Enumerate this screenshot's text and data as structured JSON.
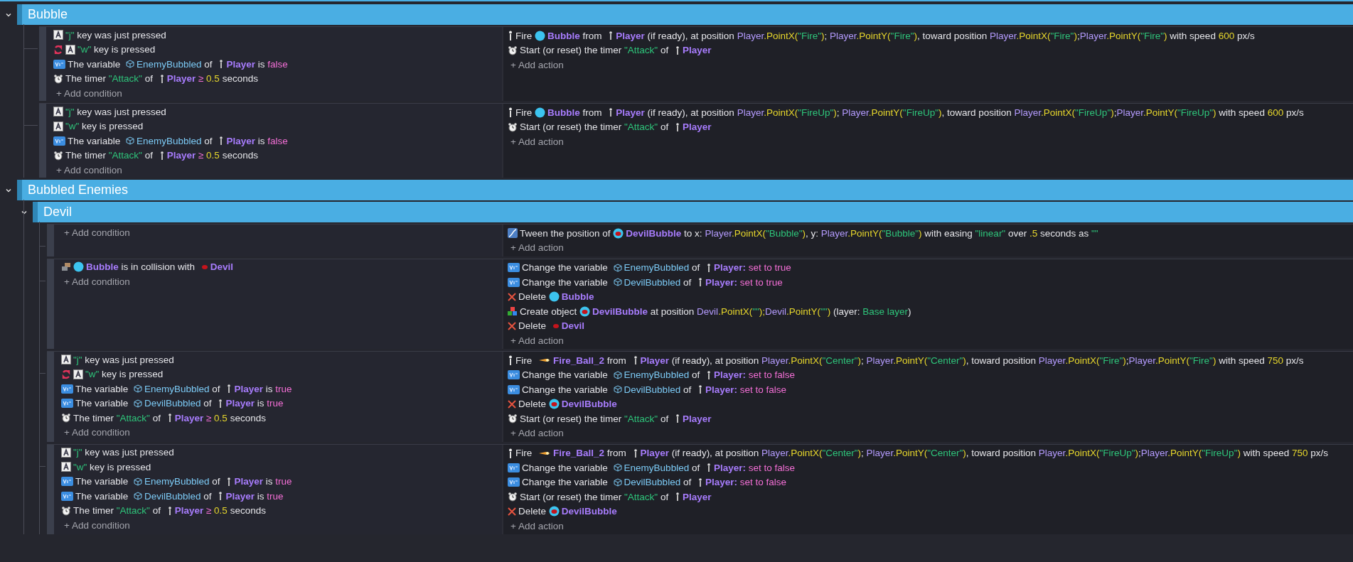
{
  "items": [
    {
      "kind": "group",
      "title": "Bubble",
      "expanded": true,
      "items": [
        {
          "kind": "event",
          "add_condition": "+ Add condition",
          "add_action": "+ Add action",
          "conditions": [
            {
              "kind": "key",
              "inverted": false,
              "parts": [
                {
                  "kind": "s",
                  "text": "\"j\""
                },
                {
                  "kind": "t",
                  "text": " key was just pressed"
                }
              ]
            },
            {
              "kind": "key",
              "inverted": true,
              "parts": [
                {
                  "kind": "s",
                  "text": "\"w\""
                },
                {
                  "kind": "t",
                  "text": " key is pressed"
                }
              ]
            },
            {
              "kind": "var",
              "inverted": false,
              "parts": [
                {
                  "kind": "t",
                  "text": "The variable "
                },
                {
                  "kind": "v",
                  "text": "EnemyBubbled"
                },
                {
                  "kind": "t",
                  "text": " of "
                },
                {
                  "kind": "player",
                  "text": "Player"
                },
                {
                  "kind": "t",
                  "text": " is "
                },
                {
                  "kind": "b",
                  "text": "false"
                }
              ]
            },
            {
              "kind": "timer",
              "inverted": false,
              "parts": [
                {
                  "kind": "t",
                  "text": "The timer "
                },
                {
                  "kind": "s",
                  "text": "\"Attack\""
                },
                {
                  "kind": "t",
                  "text": " of "
                },
                {
                  "kind": "player",
                  "text": "Player"
                },
                {
                  "kind": "b",
                  "text": " ≥ "
                },
                {
                  "kind": "n",
                  "text": "0.5"
                },
                {
                  "kind": "t",
                  "text": " seconds"
                }
              ]
            }
          ],
          "actions": [
            {
              "kind": "fire",
              "parts": [
                {
                  "kind": "t",
                  "text": "Fire "
                },
                {
                  "kind": "bubble",
                  "text": "Bubble"
                },
                {
                  "kind": "t",
                  "text": " from "
                },
                {
                  "kind": "player",
                  "text": "Player"
                },
                {
                  "kind": "t",
                  "text": " (if ready), at position "
                },
                {
                  "kind": "e",
                  "text": "Player"
                },
                {
                  "kind": "f",
                  "text": ".PointX("
                },
                {
                  "kind": "s",
                  "text": "\"Fire\""
                },
                {
                  "kind": "f",
                  "text": ")"
                },
                {
                  "kind": "t",
                  "text": "; "
                },
                {
                  "kind": "e",
                  "text": "Player"
                },
                {
                  "kind": "f",
                  "text": ".PointY("
                },
                {
                  "kind": "s",
                  "text": "\"Fire\""
                },
                {
                  "kind": "f",
                  "text": ")"
                },
                {
                  "kind": "t",
                  "text": ", toward position "
                },
                {
                  "kind": "e",
                  "text": "Player"
                },
                {
                  "kind": "f",
                  "text": ".PointX("
                },
                {
                  "kind": "s",
                  "text": "\"Fire\""
                },
                {
                  "kind": "f",
                  "text": ")"
                },
                {
                  "kind": "t",
                  "text": ";"
                },
                {
                  "kind": "e",
                  "text": "Player"
                },
                {
                  "kind": "f",
                  "text": ".PointY("
                },
                {
                  "kind": "s",
                  "text": "\"Fire\""
                },
                {
                  "kind": "f",
                  "text": ")"
                },
                {
                  "kind": "t",
                  "text": " with speed "
                },
                {
                  "kind": "n",
                  "text": "600"
                },
                {
                  "kind": "t",
                  "text": " px/s"
                }
              ]
            },
            {
              "kind": "timer",
              "parts": [
                {
                  "kind": "t",
                  "text": "Start (or reset) the timer "
                },
                {
                  "kind": "s",
                  "text": "\"Attack\""
                },
                {
                  "kind": "t",
                  "text": " of "
                },
                {
                  "kind": "player",
                  "text": "Player"
                }
              ]
            }
          ]
        },
        {
          "kind": "event",
          "add_condition": "+ Add condition",
          "add_action": "+ Add action",
          "conditions": [
            {
              "kind": "key",
              "inverted": false,
              "parts": [
                {
                  "kind": "s",
                  "text": "\"j\""
                },
                {
                  "kind": "t",
                  "text": " key was just pressed"
                }
              ]
            },
            {
              "kind": "key",
              "inverted": false,
              "parts": [
                {
                  "kind": "s",
                  "text": "\"w\""
                },
                {
                  "kind": "t",
                  "text": " key is pressed"
                }
              ]
            },
            {
              "kind": "var",
              "inverted": false,
              "parts": [
                {
                  "kind": "t",
                  "text": "The variable "
                },
                {
                  "kind": "v",
                  "text": "EnemyBubbled"
                },
                {
                  "kind": "t",
                  "text": " of "
                },
                {
                  "kind": "player",
                  "text": "Player"
                },
                {
                  "kind": "t",
                  "text": " is "
                },
                {
                  "kind": "b",
                  "text": "false"
                }
              ]
            },
            {
              "kind": "timer",
              "inverted": false,
              "parts": [
                {
                  "kind": "t",
                  "text": "The timer "
                },
                {
                  "kind": "s",
                  "text": "\"Attack\""
                },
                {
                  "kind": "t",
                  "text": " of "
                },
                {
                  "kind": "player",
                  "text": "Player"
                },
                {
                  "kind": "b",
                  "text": " ≥ "
                },
                {
                  "kind": "n",
                  "text": "0.5"
                },
                {
                  "kind": "t",
                  "text": " seconds"
                }
              ]
            }
          ],
          "actions": [
            {
              "kind": "fire",
              "parts": [
                {
                  "kind": "t",
                  "text": "Fire "
                },
                {
                  "kind": "bubble",
                  "text": "Bubble"
                },
                {
                  "kind": "t",
                  "text": " from "
                },
                {
                  "kind": "player",
                  "text": "Player"
                },
                {
                  "kind": "t",
                  "text": " (if ready), at position "
                },
                {
                  "kind": "e",
                  "text": "Player"
                },
                {
                  "kind": "f",
                  "text": ".PointX("
                },
                {
                  "kind": "s",
                  "text": "\"FireUp\""
                },
                {
                  "kind": "f",
                  "text": ")"
                },
                {
                  "kind": "t",
                  "text": "; "
                },
                {
                  "kind": "e",
                  "text": "Player"
                },
                {
                  "kind": "f",
                  "text": ".PointY("
                },
                {
                  "kind": "s",
                  "text": "\"FireUp\""
                },
                {
                  "kind": "f",
                  "text": ")"
                },
                {
                  "kind": "t",
                  "text": ", toward position "
                },
                {
                  "kind": "e",
                  "text": "Player"
                },
                {
                  "kind": "f",
                  "text": ".PointX("
                },
                {
                  "kind": "s",
                  "text": "\"FireUp\""
                },
                {
                  "kind": "f",
                  "text": ")"
                },
                {
                  "kind": "t",
                  "text": ";"
                },
                {
                  "kind": "e",
                  "text": "Player"
                },
                {
                  "kind": "f",
                  "text": ".PointY("
                },
                {
                  "kind": "s",
                  "text": "\"FireUp\""
                },
                {
                  "kind": "f",
                  "text": ")"
                },
                {
                  "kind": "t",
                  "text": " with speed "
                },
                {
                  "kind": "n",
                  "text": "600"
                },
                {
                  "kind": "t",
                  "text": " px/s"
                }
              ]
            },
            {
              "kind": "timer",
              "parts": [
                {
                  "kind": "t",
                  "text": "Start (or reset) the timer "
                },
                {
                  "kind": "s",
                  "text": "\"Attack\""
                },
                {
                  "kind": "t",
                  "text": " of "
                },
                {
                  "kind": "player",
                  "text": "Player"
                }
              ]
            }
          ]
        }
      ]
    },
    {
      "kind": "group",
      "title": "Bubbled Enemies",
      "expanded": true,
      "items": [
        {
          "kind": "group",
          "title": "Devil",
          "expanded": true,
          "items": [
            {
              "kind": "event",
              "add_condition": "+ Add condition",
              "add_action": "+ Add action",
              "actions": [
                {
                  "kind": "tween",
                  "parts": [
                    {
                      "kind": "t",
                      "text": "Tween the position of "
                    },
                    {
                      "kind": "devilbubble",
                      "text": "DevilBubble"
                    },
                    {
                      "kind": "t",
                      "text": " to x: "
                    },
                    {
                      "kind": "e",
                      "text": "Player"
                    },
                    {
                      "kind": "f",
                      "text": ".PointX("
                    },
                    {
                      "kind": "s",
                      "text": "\"Bubble\""
                    },
                    {
                      "kind": "f",
                      "text": ")"
                    },
                    {
                      "kind": "t",
                      "text": ", y: "
                    },
                    {
                      "kind": "e",
                      "text": "Player"
                    },
                    {
                      "kind": "f",
                      "text": ".PointY("
                    },
                    {
                      "kind": "s",
                      "text": "\"Bubble\""
                    },
                    {
                      "kind": "f",
                      "text": ")"
                    },
                    {
                      "kind": "t",
                      "text": " with easing "
                    },
                    {
                      "kind": "s",
                      "text": "\"linear\""
                    },
                    {
                      "kind": "t",
                      "text": " over "
                    },
                    {
                      "kind": "n",
                      "text": ".5"
                    },
                    {
                      "kind": "t",
                      "text": " seconds as "
                    },
                    {
                      "kind": "s",
                      "text": "\"\""
                    }
                  ]
                }
              ]
            },
            {
              "kind": "event",
              "add_condition": "+ Add condition",
              "add_action": "+ Add action",
              "conditions": [
                {
                  "kind": "collision",
                  "inverted": false,
                  "parts": [
                    {
                      "kind": "bubble",
                      "text": "Bubble"
                    },
                    {
                      "kind": "t",
                      "text": " is in collision with "
                    },
                    {
                      "kind": "devil",
                      "text": "Devil"
                    }
                  ]
                }
              ],
              "actions": [
                {
                  "kind": "var",
                  "parts": [
                    {
                      "kind": "t",
                      "text": "Change the variable "
                    },
                    {
                      "kind": "v",
                      "text": "EnemyBubbled"
                    },
                    {
                      "kind": "t",
                      "text": " of "
                    },
                    {
                      "kind": "player",
                      "text": "Player:"
                    },
                    {
                      "kind": "b",
                      "text": " set to true"
                    }
                  ]
                },
                {
                  "kind": "var",
                  "parts": [
                    {
                      "kind": "t",
                      "text": "Change the variable "
                    },
                    {
                      "kind": "v",
                      "text": "DevilBubbled"
                    },
                    {
                      "kind": "t",
                      "text": " of "
                    },
                    {
                      "kind": "player",
                      "text": "Player:"
                    },
                    {
                      "kind": "b",
                      "text": " set to true"
                    }
                  ]
                },
                {
                  "kind": "delete",
                  "parts": [
                    {
                      "kind": "t",
                      "text": "Delete "
                    },
                    {
                      "kind": "bubble",
                      "text": "Bubble"
                    }
                  ]
                },
                {
                  "kind": "create",
                  "parts": [
                    {
                      "kind": "t",
                      "text": "Create object "
                    },
                    {
                      "kind": "devilbubble",
                      "text": "DevilBubble"
                    },
                    {
                      "kind": "t",
                      "text": " at position "
                    },
                    {
                      "kind": "e",
                      "text": "Devil"
                    },
                    {
                      "kind": "f",
                      "text": ".PointX("
                    },
                    {
                      "kind": "s",
                      "text": "\"\""
                    },
                    {
                      "kind": "f",
                      "text": ");"
                    },
                    {
                      "kind": "e",
                      "text": "Devil"
                    },
                    {
                      "kind": "f",
                      "text": ".PointY("
                    },
                    {
                      "kind": "s",
                      "text": "\"\""
                    },
                    {
                      "kind": "f",
                      "text": ")"
                    },
                    {
                      "kind": "t",
                      "text": " (layer: "
                    },
                    {
                      "kind": "s",
                      "text": "Base layer"
                    },
                    {
                      "kind": "t",
                      "text": ")"
                    }
                  ]
                },
                {
                  "kind": "delete",
                  "parts": [
                    {
                      "kind": "t",
                      "text": "Delete "
                    },
                    {
                      "kind": "devil",
                      "text": "Devil"
                    }
                  ]
                }
              ]
            },
            {
              "kind": "event",
              "add_condition": "+ Add condition",
              "add_action": "+ Add action",
              "conditions": [
                {
                  "kind": "key",
                  "inverted": false,
                  "parts": [
                    {
                      "kind": "s",
                      "text": "\"j\""
                    },
                    {
                      "kind": "t",
                      "text": " key was just pressed"
                    }
                  ]
                },
                {
                  "kind": "key",
                  "inverted": true,
                  "parts": [
                    {
                      "kind": "s",
                      "text": "\"w\""
                    },
                    {
                      "kind": "t",
                      "text": " key is pressed"
                    }
                  ]
                },
                {
                  "kind": "var",
                  "inverted": false,
                  "parts": [
                    {
                      "kind": "t",
                      "text": "The variable "
                    },
                    {
                      "kind": "v",
                      "text": "EnemyBubbled"
                    },
                    {
                      "kind": "t",
                      "text": " of "
                    },
                    {
                      "kind": "player",
                      "text": "Player"
                    },
                    {
                      "kind": "t",
                      "text": " is "
                    },
                    {
                      "kind": "b",
                      "text": "true"
                    }
                  ]
                },
                {
                  "kind": "var",
                  "inverted": false,
                  "parts": [
                    {
                      "kind": "t",
                      "text": "The variable "
                    },
                    {
                      "kind": "v",
                      "text": "DevilBubbled"
                    },
                    {
                      "kind": "t",
                      "text": " of "
                    },
                    {
                      "kind": "player",
                      "text": "Player"
                    },
                    {
                      "kind": "t",
                      "text": " is "
                    },
                    {
                      "kind": "b",
                      "text": "true"
                    }
                  ]
                },
                {
                  "kind": "timer",
                  "inverted": false,
                  "parts": [
                    {
                      "kind": "t",
                      "text": "The timer "
                    },
                    {
                      "kind": "s",
                      "text": "\"Attack\""
                    },
                    {
                      "kind": "t",
                      "text": " of "
                    },
                    {
                      "kind": "player",
                      "text": "Player"
                    },
                    {
                      "kind": "b",
                      "text": " ≥ "
                    },
                    {
                      "kind": "n",
                      "text": "0.5"
                    },
                    {
                      "kind": "t",
                      "text": " seconds"
                    }
                  ]
                }
              ],
              "actions": [
                {
                  "kind": "fire",
                  "parts": [
                    {
                      "kind": "t",
                      "text": "Fire "
                    },
                    {
                      "kind": "fireball",
                      "text": "Fire_Ball_2"
                    },
                    {
                      "kind": "t",
                      "text": " from "
                    },
                    {
                      "kind": "player",
                      "text": "Player"
                    },
                    {
                      "kind": "t",
                      "text": " (if ready), at position "
                    },
                    {
                      "kind": "e",
                      "text": "Player"
                    },
                    {
                      "kind": "f",
                      "text": ".PointX("
                    },
                    {
                      "kind": "s",
                      "text": "\"Center\""
                    },
                    {
                      "kind": "f",
                      "text": ")"
                    },
                    {
                      "kind": "t",
                      "text": "; "
                    },
                    {
                      "kind": "e",
                      "text": "Player"
                    },
                    {
                      "kind": "f",
                      "text": ".PointY("
                    },
                    {
                      "kind": "s",
                      "text": "\"Center\""
                    },
                    {
                      "kind": "f",
                      "text": ")"
                    },
                    {
                      "kind": "t",
                      "text": ", toward position "
                    },
                    {
                      "kind": "e",
                      "text": "Player"
                    },
                    {
                      "kind": "f",
                      "text": ".PointX("
                    },
                    {
                      "kind": "s",
                      "text": "\"Fire\""
                    },
                    {
                      "kind": "f",
                      "text": ")"
                    },
                    {
                      "kind": "t",
                      "text": ";"
                    },
                    {
                      "kind": "e",
                      "text": "Player"
                    },
                    {
                      "kind": "f",
                      "text": ".PointY("
                    },
                    {
                      "kind": "s",
                      "text": "\"Fire\""
                    },
                    {
                      "kind": "f",
                      "text": ")"
                    },
                    {
                      "kind": "t",
                      "text": " with speed "
                    },
                    {
                      "kind": "n",
                      "text": "750"
                    },
                    {
                      "kind": "t",
                      "text": " px/s"
                    }
                  ]
                },
                {
                  "kind": "var",
                  "parts": [
                    {
                      "kind": "t",
                      "text": "Change the variable "
                    },
                    {
                      "kind": "v",
                      "text": "EnemyBubbled"
                    },
                    {
                      "kind": "t",
                      "text": " of "
                    },
                    {
                      "kind": "player",
                      "text": "Player:"
                    },
                    {
                      "kind": "b",
                      "text": " set to false"
                    }
                  ]
                },
                {
                  "kind": "var",
                  "parts": [
                    {
                      "kind": "t",
                      "text": "Change the variable "
                    },
                    {
                      "kind": "v",
                      "text": "DevilBubbled"
                    },
                    {
                      "kind": "t",
                      "text": " of "
                    },
                    {
                      "kind": "player",
                      "text": "Player:"
                    },
                    {
                      "kind": "b",
                      "text": " set to false"
                    }
                  ]
                },
                {
                  "kind": "delete",
                  "parts": [
                    {
                      "kind": "t",
                      "text": "Delete "
                    },
                    {
                      "kind": "devilbubble",
                      "text": "DevilBubble"
                    }
                  ]
                },
                {
                  "kind": "timer",
                  "parts": [
                    {
                      "kind": "t",
                      "text": "Start (or reset) the timer "
                    },
                    {
                      "kind": "s",
                      "text": "\"Attack\""
                    },
                    {
                      "kind": "t",
                      "text": " of "
                    },
                    {
                      "kind": "player",
                      "text": "Player"
                    }
                  ]
                }
              ]
            },
            {
              "kind": "event",
              "add_condition": "+ Add condition",
              "add_action": "+ Add action",
              "conditions": [
                {
                  "kind": "key",
                  "inverted": false,
                  "parts": [
                    {
                      "kind": "s",
                      "text": "\"j\""
                    },
                    {
                      "kind": "t",
                      "text": " key was just pressed"
                    }
                  ]
                },
                {
                  "kind": "key",
                  "inverted": false,
                  "parts": [
                    {
                      "kind": "s",
                      "text": "\"w\""
                    },
                    {
                      "kind": "t",
                      "text": " key is pressed"
                    }
                  ]
                },
                {
                  "kind": "var",
                  "inverted": false,
                  "parts": [
                    {
                      "kind": "t",
                      "text": "The variable "
                    },
                    {
                      "kind": "v",
                      "text": "EnemyBubbled"
                    },
                    {
                      "kind": "t",
                      "text": " of "
                    },
                    {
                      "kind": "player",
                      "text": "Player"
                    },
                    {
                      "kind": "t",
                      "text": " is "
                    },
                    {
                      "kind": "b",
                      "text": "true"
                    }
                  ]
                },
                {
                  "kind": "var",
                  "inverted": false,
                  "parts": [
                    {
                      "kind": "t",
                      "text": "The variable "
                    },
                    {
                      "kind": "v",
                      "text": "DevilBubbled"
                    },
                    {
                      "kind": "t",
                      "text": " of "
                    },
                    {
                      "kind": "player",
                      "text": "Player"
                    },
                    {
                      "kind": "t",
                      "text": " is "
                    },
                    {
                      "kind": "b",
                      "text": "true"
                    }
                  ]
                },
                {
                  "kind": "timer",
                  "inverted": false,
                  "parts": [
                    {
                      "kind": "t",
                      "text": "The timer "
                    },
                    {
                      "kind": "s",
                      "text": "\"Attack\""
                    },
                    {
                      "kind": "t",
                      "text": " of "
                    },
                    {
                      "kind": "player",
                      "text": "Player"
                    },
                    {
                      "kind": "b",
                      "text": " ≥ "
                    },
                    {
                      "kind": "n",
                      "text": "0.5"
                    },
                    {
                      "kind": "t",
                      "text": " seconds"
                    }
                  ]
                }
              ],
              "actions": [
                {
                  "kind": "fire",
                  "parts": [
                    {
                      "kind": "t",
                      "text": "Fire "
                    },
                    {
                      "kind": "fireball",
                      "text": "Fire_Ball_2"
                    },
                    {
                      "kind": "t",
                      "text": " from "
                    },
                    {
                      "kind": "player",
                      "text": "Player"
                    },
                    {
                      "kind": "t",
                      "text": " (if ready), at position "
                    },
                    {
                      "kind": "e",
                      "text": "Player"
                    },
                    {
                      "kind": "f",
                      "text": ".PointX("
                    },
                    {
                      "kind": "s",
                      "text": "\"Center\""
                    },
                    {
                      "kind": "f",
                      "text": ")"
                    },
                    {
                      "kind": "t",
                      "text": "; "
                    },
                    {
                      "kind": "e",
                      "text": "Player"
                    },
                    {
                      "kind": "f",
                      "text": ".PointY("
                    },
                    {
                      "kind": "s",
                      "text": "\"Center\""
                    },
                    {
                      "kind": "f",
                      "text": ")"
                    },
                    {
                      "kind": "t",
                      "text": ", toward position "
                    },
                    {
                      "kind": "e",
                      "text": "Player"
                    },
                    {
                      "kind": "f",
                      "text": ".PointX("
                    },
                    {
                      "kind": "s",
                      "text": "\"FireUp\""
                    },
                    {
                      "kind": "f",
                      "text": ")"
                    },
                    {
                      "kind": "t",
                      "text": ";"
                    },
                    {
                      "kind": "e",
                      "text": "Player"
                    },
                    {
                      "kind": "f",
                      "text": ".PointY("
                    },
                    {
                      "kind": "s",
                      "text": "\"FireUp\""
                    },
                    {
                      "kind": "f",
                      "text": ")"
                    },
                    {
                      "kind": "t",
                      "text": " with speed "
                    },
                    {
                      "kind": "n",
                      "text": "750"
                    },
                    {
                      "kind": "t",
                      "text": " px/s"
                    }
                  ]
                },
                {
                  "kind": "var",
                  "parts": [
                    {
                      "kind": "t",
                      "text": "Change the variable "
                    },
                    {
                      "kind": "v",
                      "text": "EnemyBubbled"
                    },
                    {
                      "kind": "t",
                      "text": " of "
                    },
                    {
                      "kind": "player",
                      "text": "Player:"
                    },
                    {
                      "kind": "b",
                      "text": " set to false"
                    }
                  ]
                },
                {
                  "kind": "var",
                  "parts": [
                    {
                      "kind": "t",
                      "text": "Change the variable "
                    },
                    {
                      "kind": "v",
                      "text": "DevilBubbled"
                    },
                    {
                      "kind": "t",
                      "text": " of "
                    },
                    {
                      "kind": "player",
                      "text": "Player:"
                    },
                    {
                      "kind": "b",
                      "text": " set to false"
                    }
                  ]
                },
                {
                  "kind": "timer",
                  "parts": [
                    {
                      "kind": "t",
                      "text": "Start (or reset) the timer "
                    },
                    {
                      "kind": "s",
                      "text": "\"Attack\""
                    },
                    {
                      "kind": "t",
                      "text": " of "
                    },
                    {
                      "kind": "player",
                      "text": "Player"
                    }
                  ]
                },
                {
                  "kind": "delete",
                  "parts": [
                    {
                      "kind": "t",
                      "text": "Delete "
                    },
                    {
                      "kind": "devilbubble",
                      "text": "DevilBubble"
                    }
                  ]
                }
              ]
            }
          ]
        }
      ]
    }
  ]
}
